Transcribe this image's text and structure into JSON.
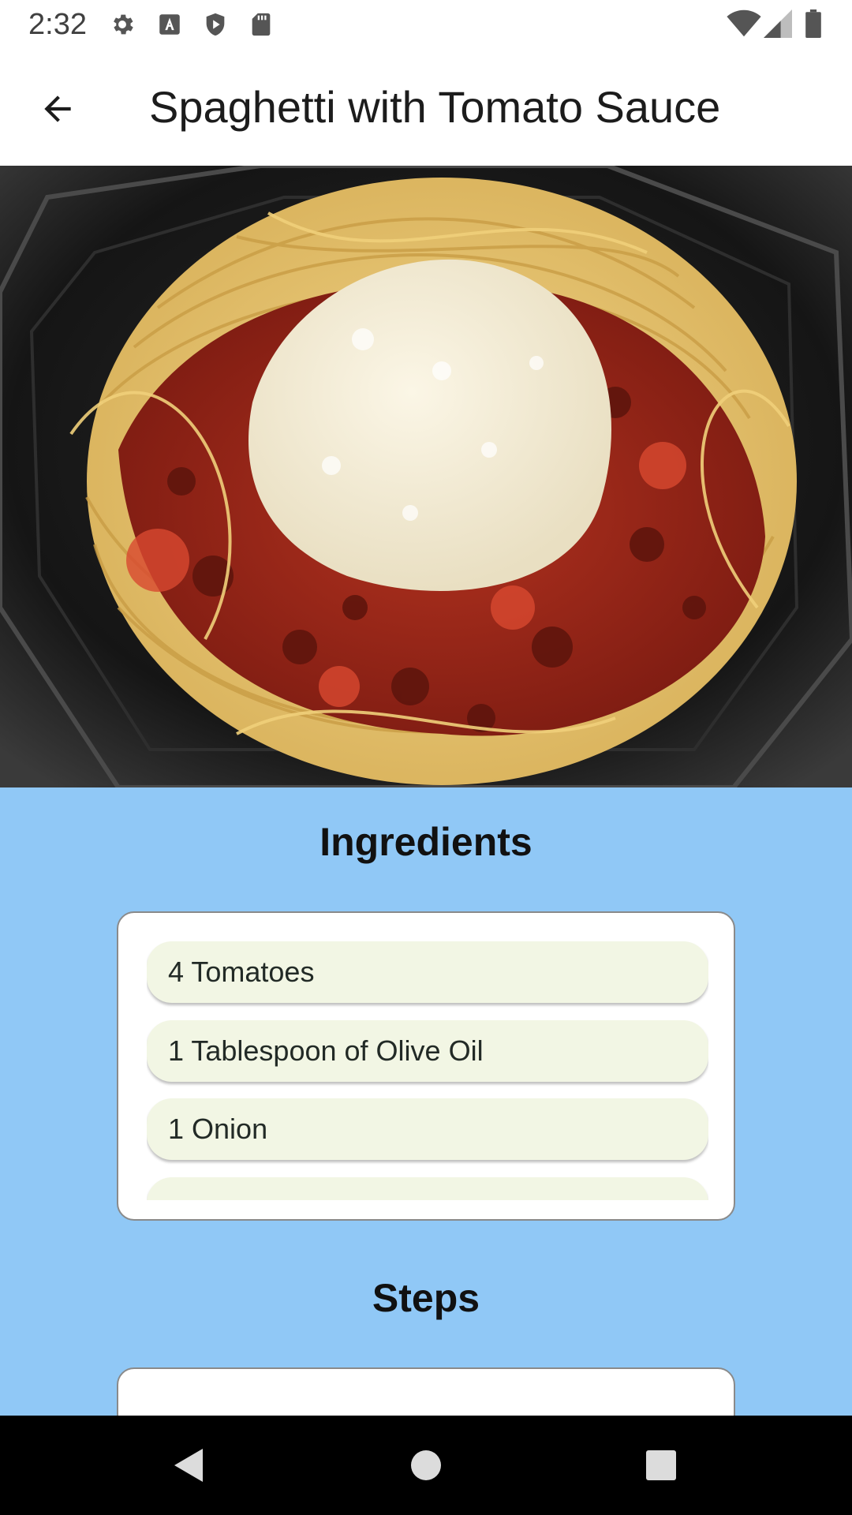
{
  "status_bar": {
    "time": "2:32",
    "left_icons": [
      "gear-icon",
      "a-letter-icon",
      "shield-play-icon",
      "sd-card-icon"
    ],
    "right_icons": [
      "wifi-icon",
      "cell-signal-icon",
      "battery-icon"
    ]
  },
  "app_bar": {
    "back_icon": "arrow-back-icon",
    "title": "Spaghetti with Tomato Sauce"
  },
  "hero_image": {
    "subject": "spaghetti-with-tomato-sauce-photo"
  },
  "ingredients": {
    "title": "Ingredients",
    "items": [
      "4 Tomatoes",
      "1 Tablespoon of Olive Oil",
      "1 Onion",
      ""
    ]
  },
  "steps": {
    "title": "Steps"
  },
  "nav_bar": {
    "back_icon": "triangle-back-icon",
    "home_icon": "circle-home-icon",
    "recents_icon": "square-recents-icon"
  },
  "colors": {
    "content_background": "#90c8f6",
    "ingredient_chip": "#f2f6e4",
    "card_border": "#8a8a8a"
  }
}
